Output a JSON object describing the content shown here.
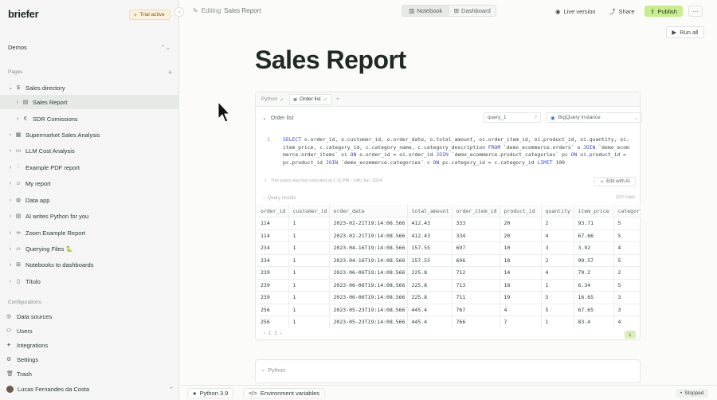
{
  "brand": "briefer",
  "trial_label": "Trial active",
  "workspace": "Demos",
  "pages_section": "Pages",
  "nav": [
    {
      "label": "Sales directory",
      "icon": "dollar-icon",
      "glyph": "$",
      "level": 0,
      "expanded": true
    },
    {
      "label": "Sales Report",
      "icon": "notebook-icon",
      "glyph": "▤",
      "level": 1,
      "active": true
    },
    {
      "label": "SDR Comissions",
      "icon": "euro-icon",
      "glyph": "€",
      "level": 1
    },
    {
      "label": "Supermarket Sales Analysis",
      "icon": "dashboard-icon",
      "glyph": "▦",
      "level": 0
    },
    {
      "label": "LLM Cost Analysis",
      "icon": "chat-icon",
      "glyph": "▭",
      "level": 0
    },
    {
      "label": "Example PDF report",
      "icon": "sliders-icon",
      "glyph": "⫶",
      "level": 0
    },
    {
      "label": "My report",
      "icon": "bot-icon",
      "glyph": "☺",
      "level": 0
    },
    {
      "label": "Data app",
      "icon": "globe-icon",
      "glyph": "◍",
      "level": 0
    },
    {
      "label": "AI writes Python for you",
      "icon": "notebook-icon",
      "glyph": "▤",
      "level": 0
    },
    {
      "label": "Zoom Example Report",
      "icon": "binoculars-icon",
      "glyph": "∞",
      "level": 0
    },
    {
      "label": "Querying Files 🐍",
      "icon": "folder-icon",
      "glyph": "▱",
      "level": 0
    },
    {
      "label": "Notebooks to dashboards",
      "icon": "grid-icon",
      "glyph": "⊞",
      "level": 0
    },
    {
      "label": "Título",
      "icon": "file-icon",
      "glyph": "▯",
      "level": 0
    }
  ],
  "config_section": "Configurations",
  "config": [
    {
      "label": "Data sources",
      "icon": "database-icon",
      "glyph": "◎"
    },
    {
      "label": "Users",
      "icon": "users-icon",
      "glyph": "⚇"
    },
    {
      "label": "Integrations",
      "icon": "integrations-icon",
      "glyph": "✦"
    },
    {
      "label": "Settings",
      "icon": "gear-icon",
      "glyph": "⚙"
    },
    {
      "label": "Trash",
      "icon": "trash-icon",
      "glyph": "🗑"
    }
  ],
  "user_name": "Lucas Fernandes da Costa",
  "topbar": {
    "editing_prefix": "Editing",
    "editing_doc": "Sales Report",
    "notebook": "Notebook",
    "dashboard": "Dashboard",
    "live_version": "Live version",
    "share": "Share",
    "publish": "Publish",
    "run_all": "Run all"
  },
  "page_title": "Sales Report",
  "block": {
    "tab_python": "Python",
    "tab_order": "Order list",
    "title": "Order list",
    "variable": "query_1",
    "datasource": "BigQuery instance",
    "line_no": "1",
    "sql_tokens": [
      {
        "t": "SELECT",
        "k": true
      },
      {
        "t": " o.order_id, o.customer_id, o.order_date, o.total_amount, oi.order_item_id, oi.product_id, oi.quantity, oi.item_price, c.category_id, c.category_name, c.category_description ",
        "k": false
      },
      {
        "t": "FROM",
        "k": true
      },
      {
        "t": " `demo_ecommerce.orders` o ",
        "k": false
      },
      {
        "t": "JOIN",
        "k": true
      },
      {
        "t": " `demo_ecommerce.order_items` oi ",
        "k": false
      },
      {
        "t": "ON",
        "k": true
      },
      {
        "t": " o.order_id = oi.order_id ",
        "k": false
      },
      {
        "t": "JOIN",
        "k": true
      },
      {
        "t": " `demo_ecommerce.product_categories` pc ",
        "k": false
      },
      {
        "t": "ON",
        "k": true
      },
      {
        "t": " oi.product_id = pc.product_id ",
        "k": false
      },
      {
        "t": "JOIN",
        "k": true
      },
      {
        "t": " `demo_ecommerce.categories` c ",
        "k": false
      },
      {
        "t": "ON",
        "k": true
      },
      {
        "t": " pc.category_id = c.category_id ",
        "k": false
      },
      {
        "t": "LIMIT",
        "k": true
      },
      {
        "t": " 100",
        "k": false
      }
    ],
    "executed_text": "This query was last executed at 1:11 PM - 14th Jun, 2024",
    "edit_ai": "Edit with AI",
    "results_label": "Query results",
    "rows_count": "100 rows",
    "columns": [
      "order_id",
      "customer_id",
      "order_date",
      "total_amount",
      "order_item_id",
      "product_id",
      "quantity",
      "item_price",
      "category_"
    ],
    "rows": [
      [
        "114",
        "1",
        "2023-02-21T19:14:08.566",
        "412.43",
        "333",
        "20",
        "2",
        "93.71",
        "5"
      ],
      [
        "114",
        "1",
        "2023-02-21T19:14:08.566",
        "412.43",
        "334",
        "20",
        "4",
        "67.66",
        "5"
      ],
      [
        "234",
        "1",
        "2023-04-16T19:14:08.566",
        "157.55",
        "697",
        "10",
        "3",
        "3.92",
        "4"
      ],
      [
        "234",
        "1",
        "2023-04-16T19:14:08.566",
        "157.55",
        "696",
        "18",
        "2",
        "99.57",
        "5"
      ],
      [
        "239",
        "1",
        "2023-06-06T19:14:08.566",
        "225.8",
        "712",
        "14",
        "4",
        "79.2",
        "2"
      ],
      [
        "239",
        "1",
        "2023-06-06T19:14:08.566",
        "225.8",
        "713",
        "18",
        "1",
        "6.34",
        "5"
      ],
      [
        "239",
        "1",
        "2023-06-06T19:14:08.566",
        "225.8",
        "711",
        "19",
        "5",
        "16.65",
        "3"
      ],
      [
        "256",
        "1",
        "2023-05-23T19:14:08.566",
        "445.4",
        "767",
        "4",
        "5",
        "67.65",
        "3"
      ],
      [
        "256",
        "1",
        "2023-05-23T19:14:08.566",
        "445.4",
        "766",
        "7",
        "1",
        "83.4",
        "4"
      ]
    ],
    "pager": [
      "‹",
      "1",
      "2",
      "›"
    ]
  },
  "block2_label": "Python",
  "status": {
    "python": "Python 3.9",
    "env": "Environment variables",
    "stopped": "Stopped"
  },
  "colors": {
    "publish": "#c9ec8c",
    "keyword": "#3b45c7",
    "trial": "#fbf1dc"
  }
}
